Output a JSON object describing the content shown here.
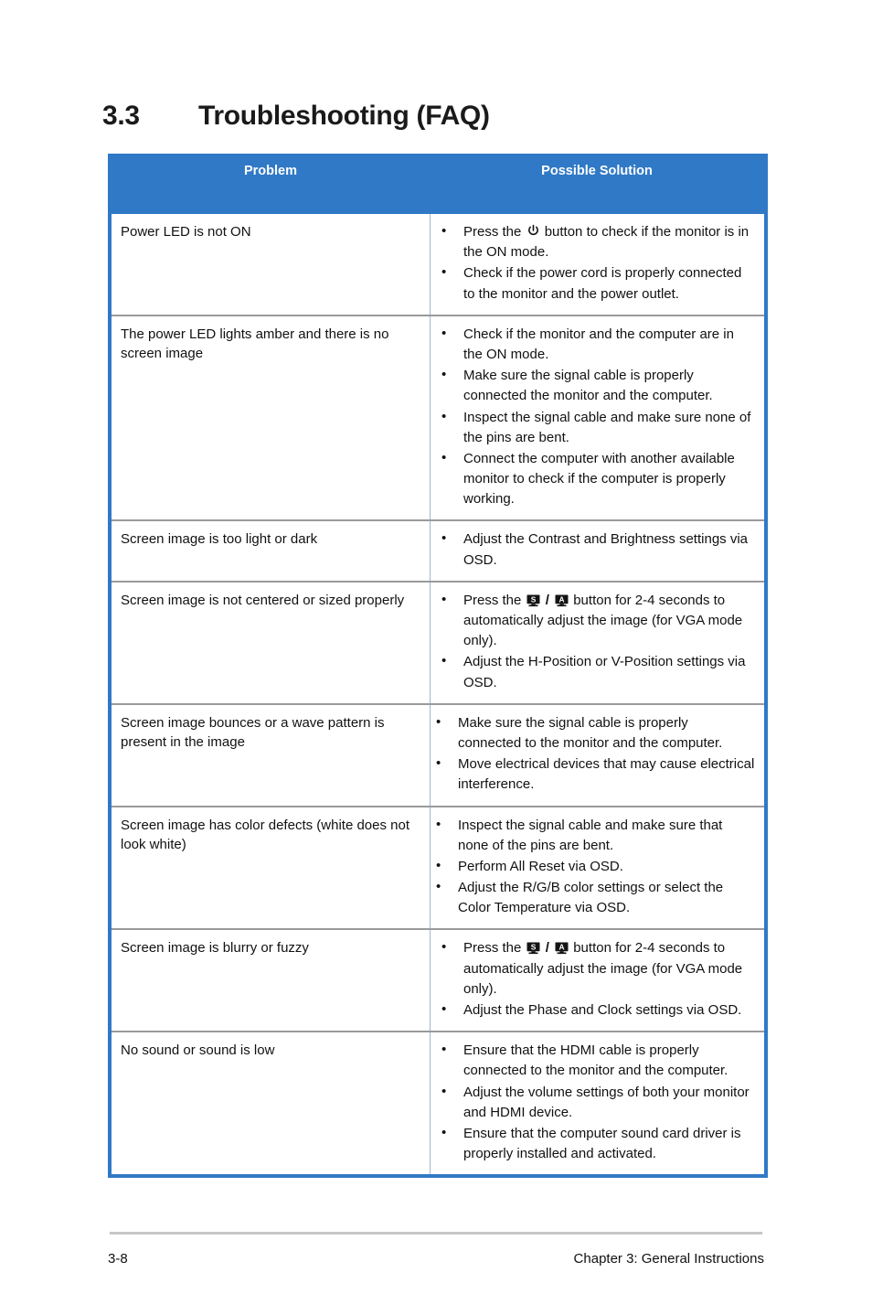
{
  "document": {
    "section_number": "3.3",
    "section_title": "Troubleshooting (FAQ)"
  },
  "table": {
    "headers": {
      "problem": "Problem",
      "solution": "Possible Solution"
    },
    "rows": [
      {
        "problem": "Power  LED is not ON",
        "solutions": [
          "Press the {power} button to check if the monitor is in the ON mode.",
          "Check if the power cord is properly connected to the monitor and the power outlet."
        ]
      },
      {
        "problem": "The power LED lights amber and there is no screen image",
        "solutions": [
          "Check if the monitor and the computer are in the ON mode.",
          "Make sure the signal cable is properly connected the monitor and the computer.",
          "Inspect the signal cable and make sure none of the pins are bent.",
          "Connect the computer with another available monitor to check if the computer is properly working."
        ]
      },
      {
        "problem": "Screen image is too light or dark",
        "solutions": [
          "Adjust the Contrast and Brightness settings via OSD."
        ]
      },
      {
        "problem": "Screen image is not centered or sized properly",
        "solutions": [
          "Press the {mon-s} / {mon-a} button for 2-4 seconds to automatically adjust the image (for VGA mode only).",
          "Adjust the H-Position or V-Position settings via OSD."
        ]
      },
      {
        "problem": "Screen image bounces or a wave pattern is present in the image",
        "solutions": [
          "Make sure the signal cable is properly connected to the monitor and the computer.",
          "Move electrical devices that may cause electrical interference."
        ]
      },
      {
        "problem": "Screen image has color defects (white does not look white)",
        "solutions": [
          "Inspect the signal cable and make sure that none of the pins are bent.",
          "Perform All Reset via OSD.",
          "Adjust the R/G/B color settings or select the Color Temperature via OSD."
        ]
      },
      {
        "problem": "Screen image is blurry or fuzzy",
        "solutions": [
          "Press the {mon-s} / {mon-a} button for 2-4 seconds to automatically adjust the image (for VGA mode only).",
          "Adjust the Phase and Clock settings via OSD."
        ]
      },
      {
        "problem": "No sound or sound is low",
        "solutions": [
          "Ensure that the HDMI cable is properly connected to the monitor and the computer.",
          "Adjust the volume settings of both your monitor and HDMI device.",
          "Ensure that the computer sound card driver is properly installed and activated."
        ]
      }
    ]
  },
  "footer": {
    "page_number": "3-8",
    "chapter_label": "Chapter 3: General Instructions"
  },
  "icons": {
    "power": "power-button-icon",
    "mon_s": "monitor-s-button-icon",
    "mon_a": "monitor-a-button-icon"
  },
  "colors": {
    "table_accent": "#3079c6",
    "divider": "#9a9a9a",
    "column_divider": "#9fb8cf",
    "footer_rule": "#c6c6c6",
    "text": "#111111"
  }
}
